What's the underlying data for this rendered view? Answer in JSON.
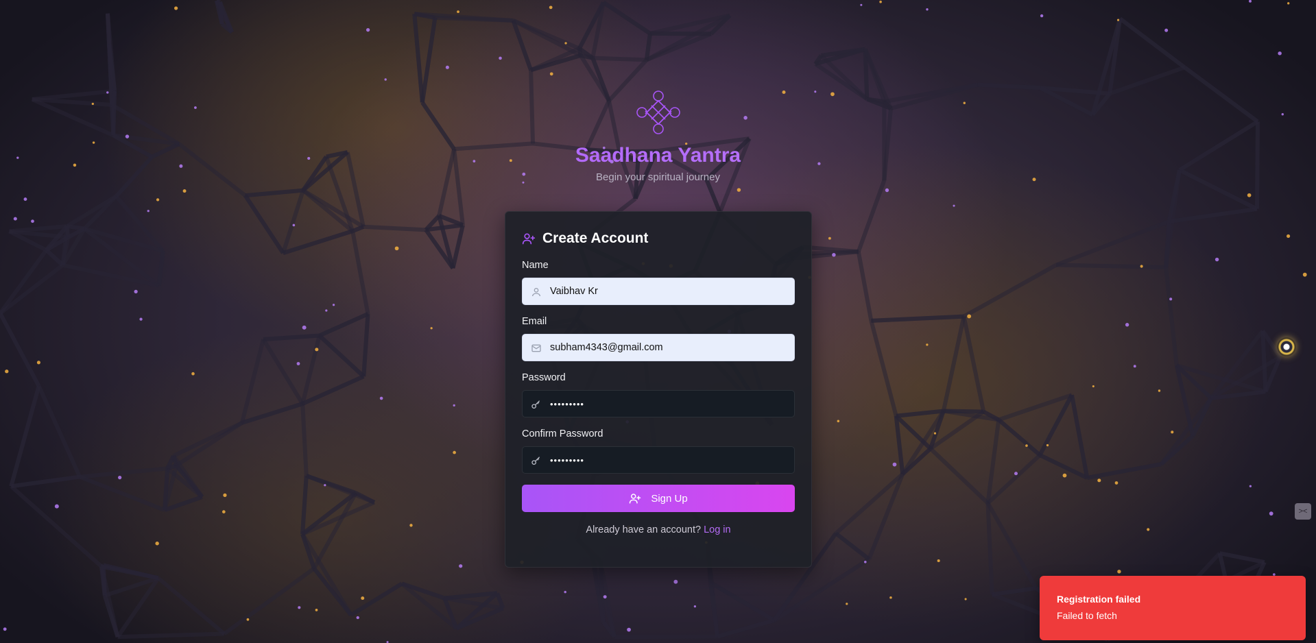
{
  "brand": {
    "title": "Saadhana Yantra",
    "subtitle": "Begin your spiritual journey",
    "logo_icon": "yantra-knot-icon"
  },
  "form": {
    "title": "Create Account",
    "header_icon": "user-plus-icon",
    "fields": {
      "name": {
        "label": "Name",
        "value": "Vaibhav Kr",
        "icon": "user-icon"
      },
      "email": {
        "label": "Email",
        "value": "subham4343@gmail.com",
        "icon": "mail-icon"
      },
      "password": {
        "label": "Password",
        "value": "•••••••••",
        "icon": "key-icon"
      },
      "confirm_password": {
        "label": "Confirm Password",
        "value": "•••••••••",
        "icon": "key-icon"
      }
    },
    "submit_label": "Sign Up",
    "footer_text": "Already have an account?",
    "login_link": "Log in"
  },
  "toast": {
    "title": "Registration failed",
    "message": "Failed to fetch"
  },
  "colors": {
    "accent": "#a855f7",
    "accent_end": "#d946ef",
    "toast_error": "#ef3b3b",
    "card_bg": "#1e2028"
  }
}
